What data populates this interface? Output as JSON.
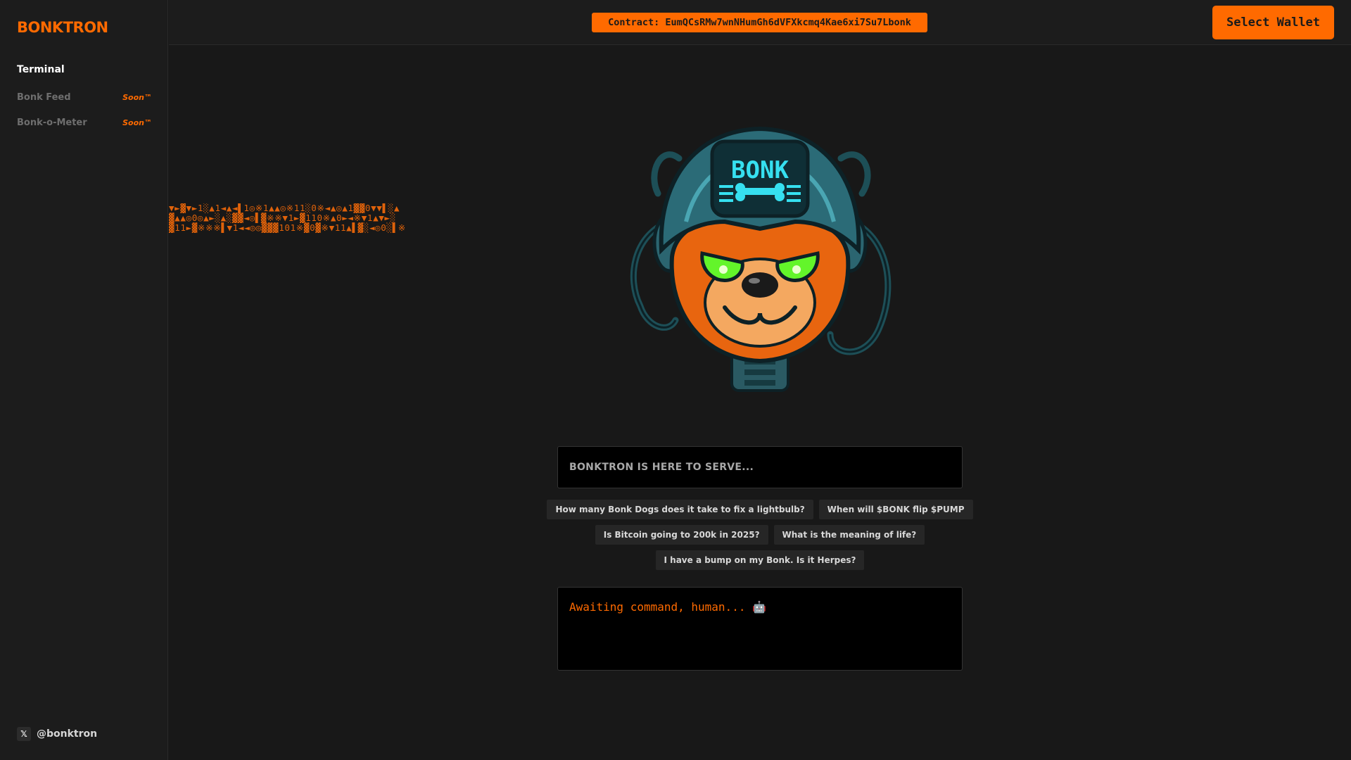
{
  "brand": {
    "logo": "BONKTRON",
    "accent": "#ff6a00",
    "background": "#181818"
  },
  "sidebar": {
    "items": [
      {
        "label": "Terminal",
        "badge": "",
        "active": true
      },
      {
        "label": "Bonk Feed",
        "badge": "Soon™",
        "active": false
      },
      {
        "label": "Bonk-o-Meter",
        "badge": "Soon™",
        "active": false
      }
    ],
    "social": {
      "icon": "x-icon",
      "icon_glyph": "𝕏",
      "handle": "@bonktron"
    }
  },
  "header": {
    "contract": "Contract: EumQCsRMw7wnNHumGh6dVFXkcmq4Kae6xi7Su7Lbonk",
    "wallet_button": "Select Wallet"
  },
  "glyph_rows": [
    "▼►▓▼►1░▲1◄▲◄▌1◎※1▲▲◎※11░0※◄▲◎▲1▓▓0▼▼▌░▲",
    "▓▲▲◎0◎▲►░▲░▓▓◄◎▌▓※※▼1►▓110※▲0►◄※▼1▲▼►░",
    "▓11►▓※※※▌▼1◄◄◎◎▓▓▓101※▓0▓※▼11▲▌▓░◄◎0░▌※"
  ],
  "mascot": {
    "icon": "bonk-bear-mascot-icon",
    "helmet_text": "BONK"
  },
  "prompt": {
    "placeholder": "BONKTRON IS HERE TO SERVE..."
  },
  "suggestions": [
    "How many Bonk Dogs does it take to fix a lightbulb?",
    "When will $BONK flip $PUMP",
    "Is Bitcoin going to 200k in 2025?",
    "What is the meaning of life?",
    "I have a bump on my Bonk. Is it Herpes?"
  ],
  "console": {
    "text": "Awaiting command, human... 🤖"
  }
}
